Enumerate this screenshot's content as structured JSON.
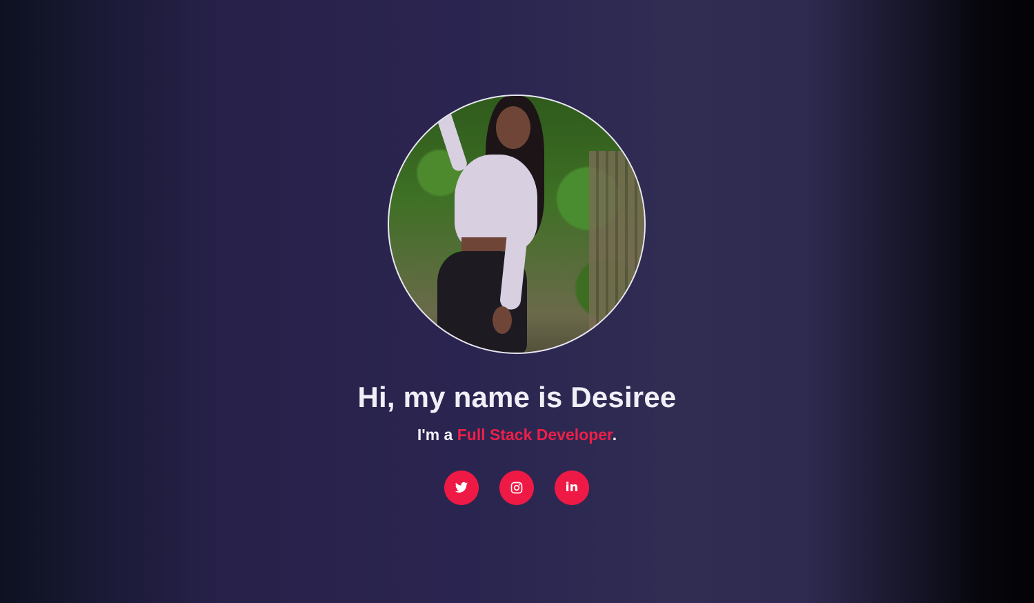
{
  "hero": {
    "avatar_alt": "Profile photo of Desiree",
    "headline": "Hi, my name is Desiree",
    "tagline_prefix": "I'm a ",
    "tagline_role": "Full Stack Developer",
    "tagline_suffix": "."
  },
  "socials": [
    {
      "name": "Twitter",
      "icon": "twitter-icon"
    },
    {
      "name": "Instagram",
      "icon": "instagram-icon"
    },
    {
      "name": "LinkedIn",
      "icon": "linkedin-icon",
      "glyph": "in"
    }
  ],
  "colors": {
    "accent": "#ee1a45",
    "text": "#f1eff7",
    "avatar_border": "#e9e6f2"
  }
}
